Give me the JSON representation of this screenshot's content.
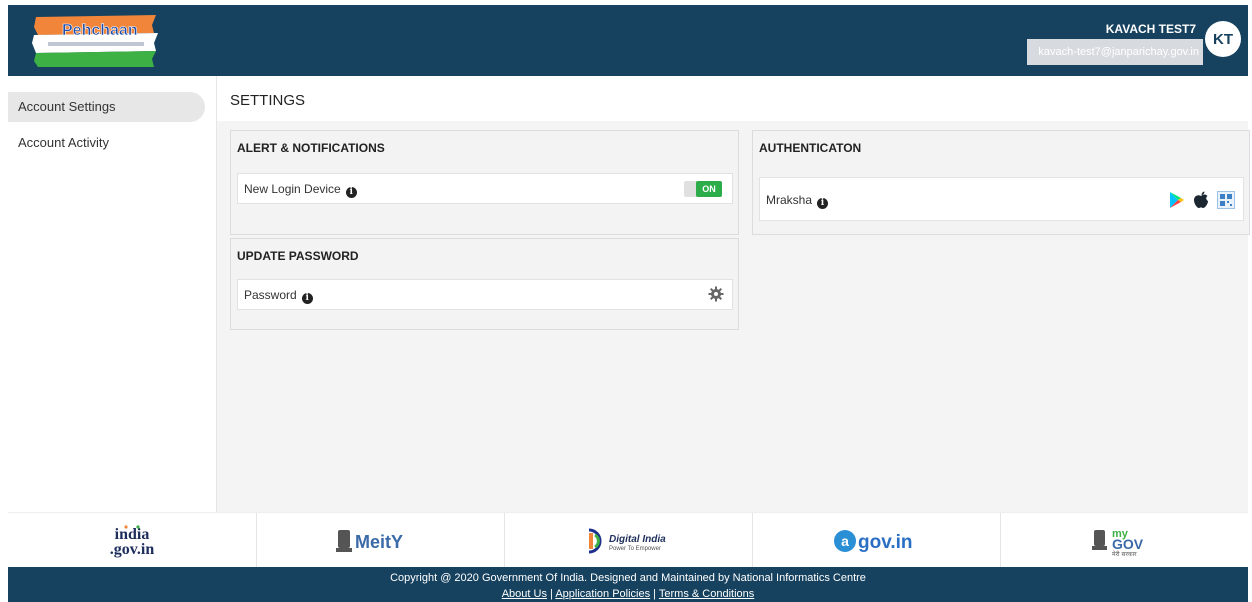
{
  "header": {
    "user_name": "KAVACH TEST7",
    "user_email": "kavach-test7@janparichay.gov.in",
    "avatar_initials": "KT",
    "logo_text": "Pehchaan",
    "background": "#16425f"
  },
  "sidebar": {
    "items": [
      {
        "label": "Account Settings",
        "active": true
      },
      {
        "label": "Account Activity",
        "active": false
      }
    ]
  },
  "main": {
    "title": "SETTINGS",
    "alerts": {
      "title": "ALERT & NOTIFICATIONS",
      "new_login_label": "New Login Device",
      "toggle_label": "ON"
    },
    "password": {
      "title": "UPDATE PASSWORD",
      "password_label": "Password"
    },
    "auth": {
      "title": "AUTHENTICATON",
      "mraksha_label": "Mraksha"
    }
  },
  "footer": {
    "logos": [
      "india.gov.in",
      "MeitY",
      "Digital India",
      "@gov.in",
      "myGov"
    ],
    "copyright": "Copyright @ 2020 Government Of India. Designed and Maintained by National Informatics Centre",
    "links": [
      "About Us",
      "Application Policies",
      "Terms & Conditions"
    ],
    "link_separator": " | "
  }
}
